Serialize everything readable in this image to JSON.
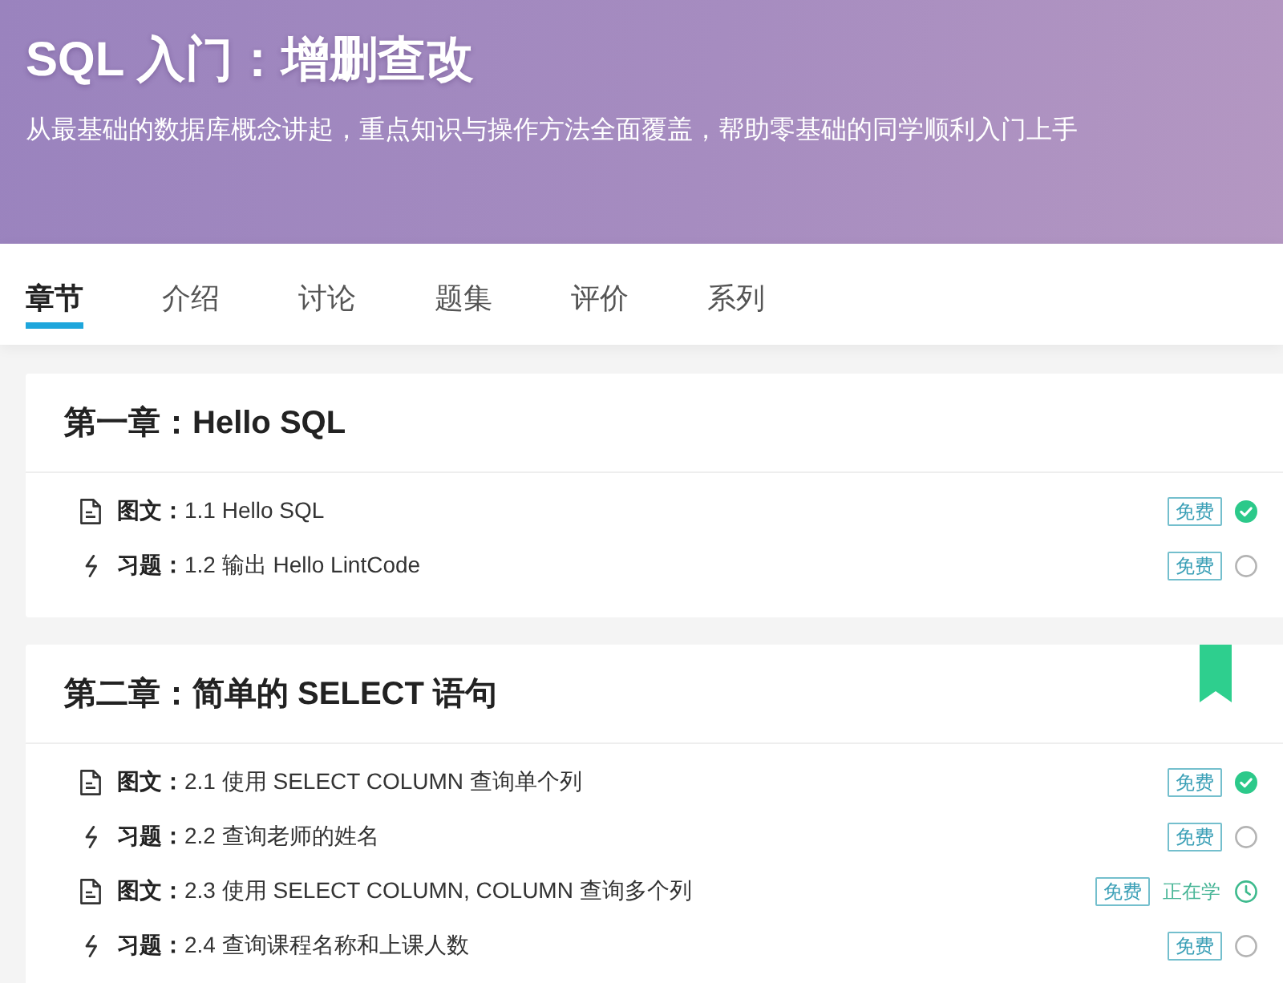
{
  "header": {
    "title": "SQL 入门：增删查改",
    "subtitle": "从最基础的数据库概念讲起，重点知识与操作方法全面覆盖，帮助零基础的同学顺利入门上手"
  },
  "tabs": [
    {
      "label": "章节",
      "selected": true
    },
    {
      "label": "介绍",
      "selected": false
    },
    {
      "label": "讨论",
      "selected": false
    },
    {
      "label": "题集",
      "selected": false
    },
    {
      "label": "评价",
      "selected": false
    },
    {
      "label": "系列",
      "selected": false
    }
  ],
  "chapters": [
    {
      "title": "第一章：Hello SQL",
      "bookmarked": false,
      "lessons": [
        {
          "kind": "article",
          "title": "**图文：**1.1 Hello SQL",
          "badge": "免费",
          "done": true,
          "learning": false
        },
        {
          "kind": "exercise",
          "title": "**习题：**1.2 输出 Hello LintCode",
          "badge": "免费",
          "done": false,
          "learning": false
        }
      ]
    },
    {
      "title": "第二章：简单的 SELECT 语句",
      "bookmarked": true,
      "lessons": [
        {
          "kind": "article",
          "title": "**图文：**2.1 使用 SELECT COLUMN 查询单个列",
          "badge": "免费",
          "done": true,
          "learning": false
        },
        {
          "kind": "exercise",
          "title": "**习题：**2.2 查询老师的姓名",
          "badge": "免费",
          "done": false,
          "learning": false
        },
        {
          "kind": "article",
          "title": "**图文：**2.3 使用 SELECT COLUMN, COLUMN 查询多个列",
          "badge": "免费",
          "done": false,
          "learning": true,
          "status_text": "正在学"
        },
        {
          "kind": "exercise",
          "title": "**习题：**2.4 查询课程名称和上课人数",
          "badge": "免费",
          "done": false,
          "learning": false
        }
      ]
    }
  ]
}
